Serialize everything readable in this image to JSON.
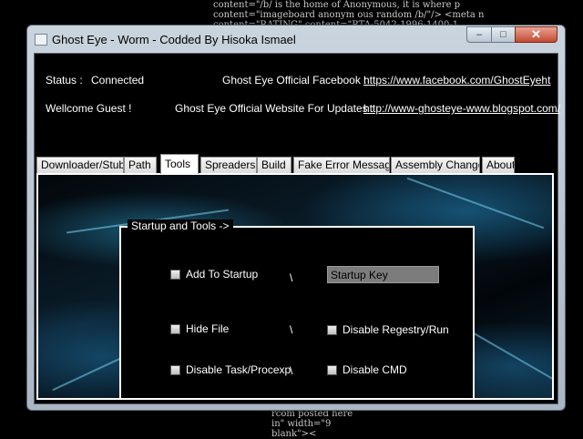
{
  "background_text": {
    "lines_top": [
      "content=\"/b/ is the home of Anonymous, it is where p",
      "content=\"imageboard anonym ous random /b/\"/> <meta n",
      "content=\"RATING\" content=\"RTA-5042-1996-1400-1"
    ],
    "lines_bottom": [
      "rcom posted here",
      "in\" width=\"9",
      "blank\"><"
    ]
  },
  "window": {
    "title": "Ghost Eye - Worm - Codded By Hisoka Ismael",
    "minimize_glyph": "–",
    "maximize_glyph": "□",
    "close_glyph": "✕"
  },
  "info": {
    "status_label": "Status :",
    "status_value": "Connected",
    "welcome": "Wellcome Guest !",
    "facebook_label": "Ghost Eye Official Facebook :",
    "facebook_link": "https://www.facebook.com/GhostEyeht",
    "website_label": "Ghost Eye Official Website For Updates :",
    "website_link": "http://www-ghosteye-www.blogspot.com/"
  },
  "tabs": [
    {
      "label": "Downloader/Stub"
    },
    {
      "label": "Path"
    },
    {
      "label": "Tools"
    },
    {
      "label": "Spreaders"
    },
    {
      "label": "Build"
    },
    {
      "label": "Fake Error Message"
    },
    {
      "label": "Assembly Changer"
    },
    {
      "label": "About"
    }
  ],
  "active_tab": "Tools",
  "group": {
    "legend": "Startup and Tools ->",
    "add_to_startup": "Add To Startup",
    "startup_key_value": "Startup Key",
    "hide_file": "Hide File",
    "disable_registry": "Disable Regestry/Run",
    "disable_task": "Disable Task/Procexp",
    "disable_cmd": "Disable CMD",
    "separator": "\\"
  },
  "colors": {
    "client_background": "#000000",
    "text": "#ffffff",
    "title_bar": "#b9c6d2",
    "close_button": "#c44a32"
  }
}
